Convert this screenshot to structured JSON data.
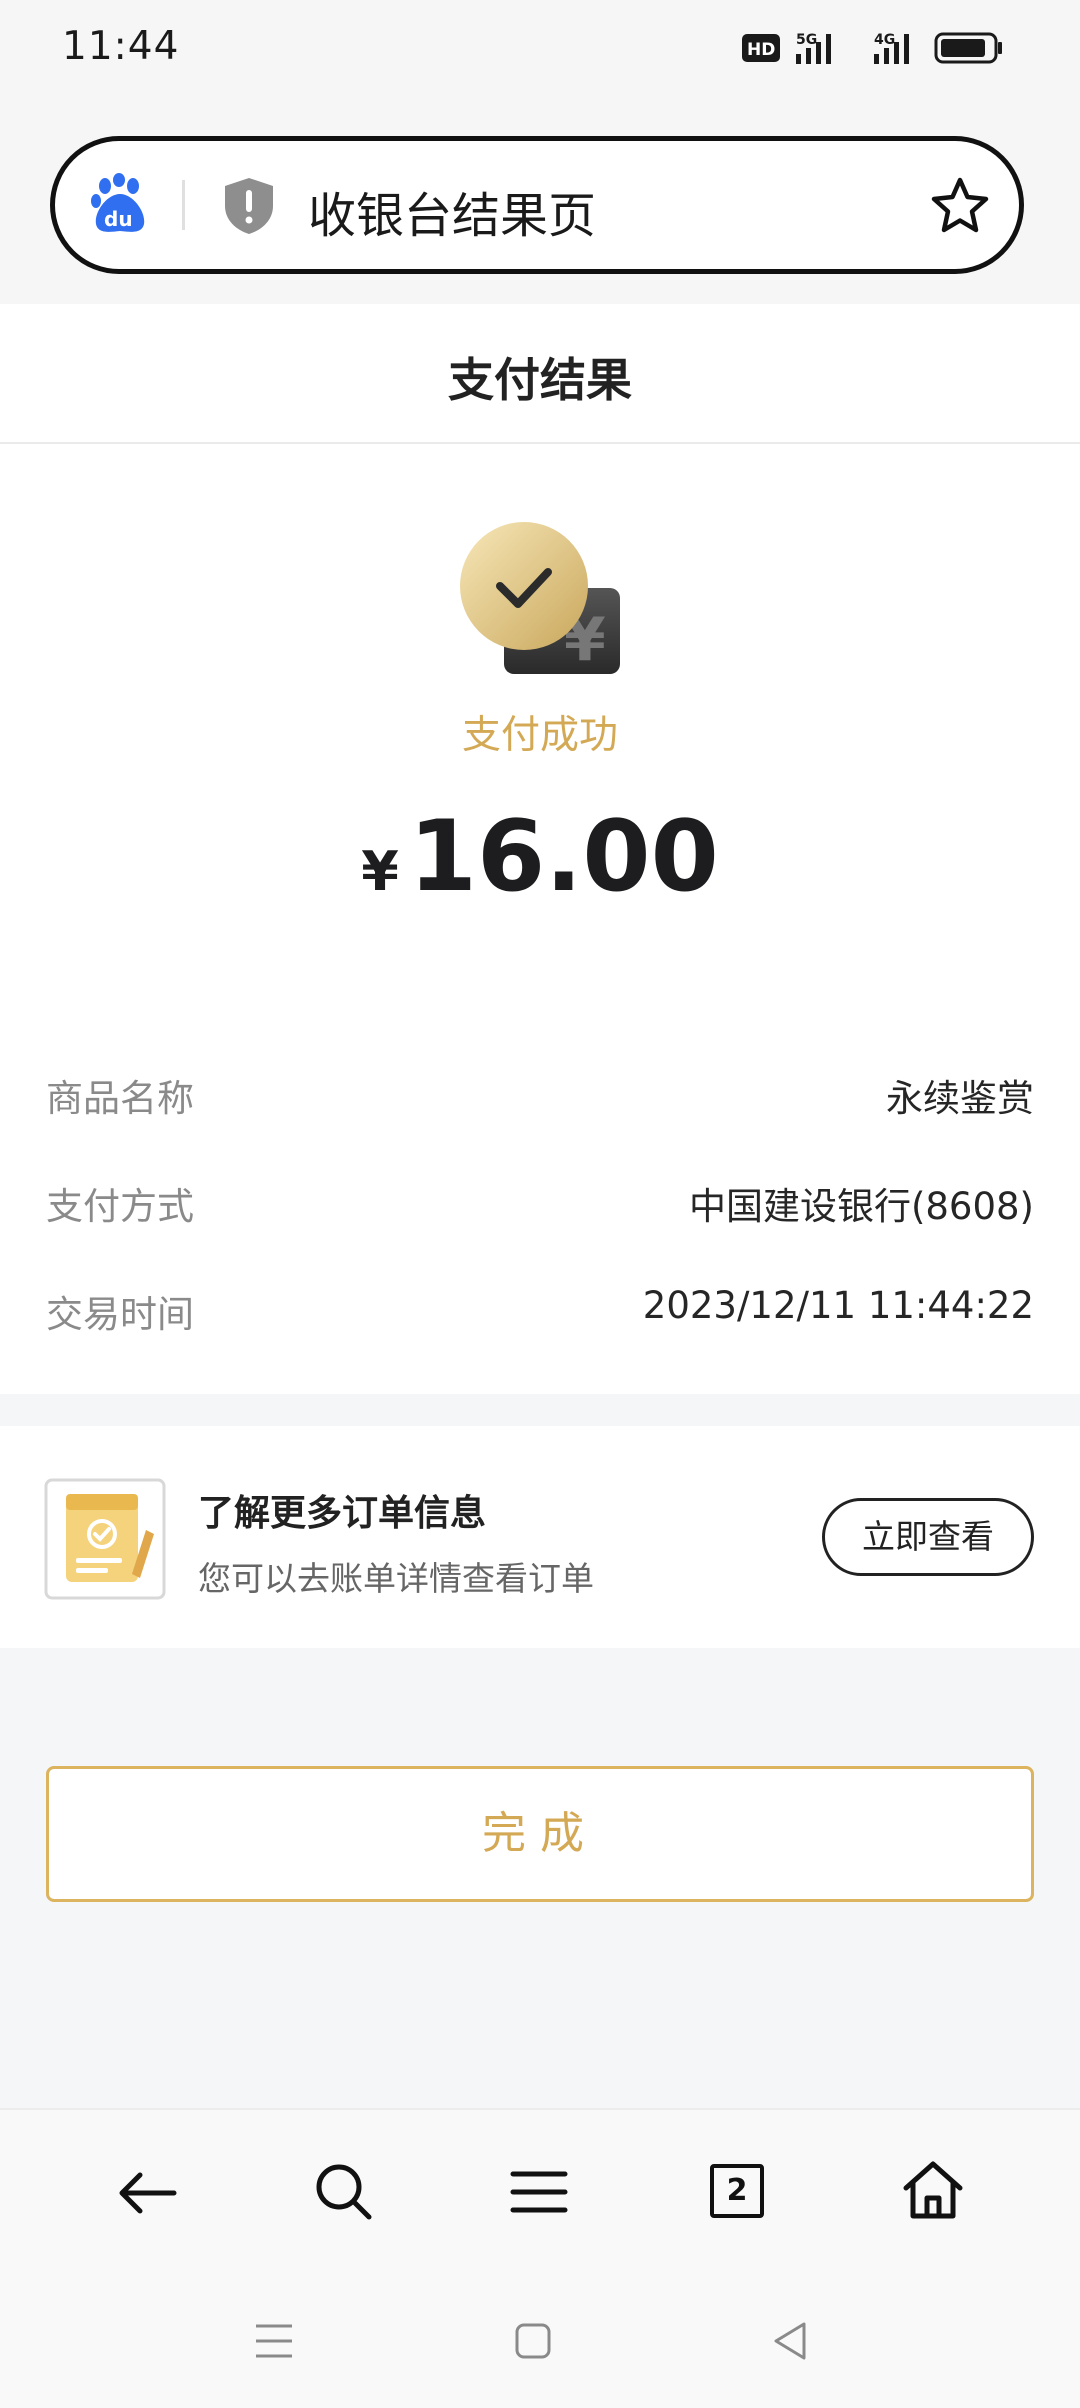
{
  "status_bar": {
    "time": "11:44"
  },
  "url_bar": {
    "title": "收银台结果页"
  },
  "header": {
    "title": "支付结果"
  },
  "result": {
    "status": "支付成功",
    "currency_symbol": "¥",
    "amount": "16.00"
  },
  "details": [
    {
      "label": "商品名称",
      "value": "永续鉴赏"
    },
    {
      "label": "支付方式",
      "value": "中国建设银行(8608)"
    },
    {
      "label": "交易时间",
      "value": "2023/12/11 11:44:22"
    }
  ],
  "order_info": {
    "title": "了解更多订单信息",
    "subtitle": "您可以去账单详情查看订单",
    "button_label": "立即查看"
  },
  "done_button": {
    "label": "完成"
  },
  "toolbar": {
    "tab_count": "2"
  },
  "colors": {
    "accent": "#d4a955",
    "page_bg": "#f5f6f8",
    "baidu_blue": "#2f6ff0"
  },
  "icons": [
    "baidu-logo-icon",
    "shield-icon",
    "star-icon",
    "check-icon",
    "yen-wallet-icon",
    "order-doc-icon",
    "back-arrow-icon",
    "search-icon",
    "menu-icon",
    "tabs-icon",
    "home-icon",
    "system-menu-icon",
    "system-home-icon",
    "system-back-icon"
  ]
}
